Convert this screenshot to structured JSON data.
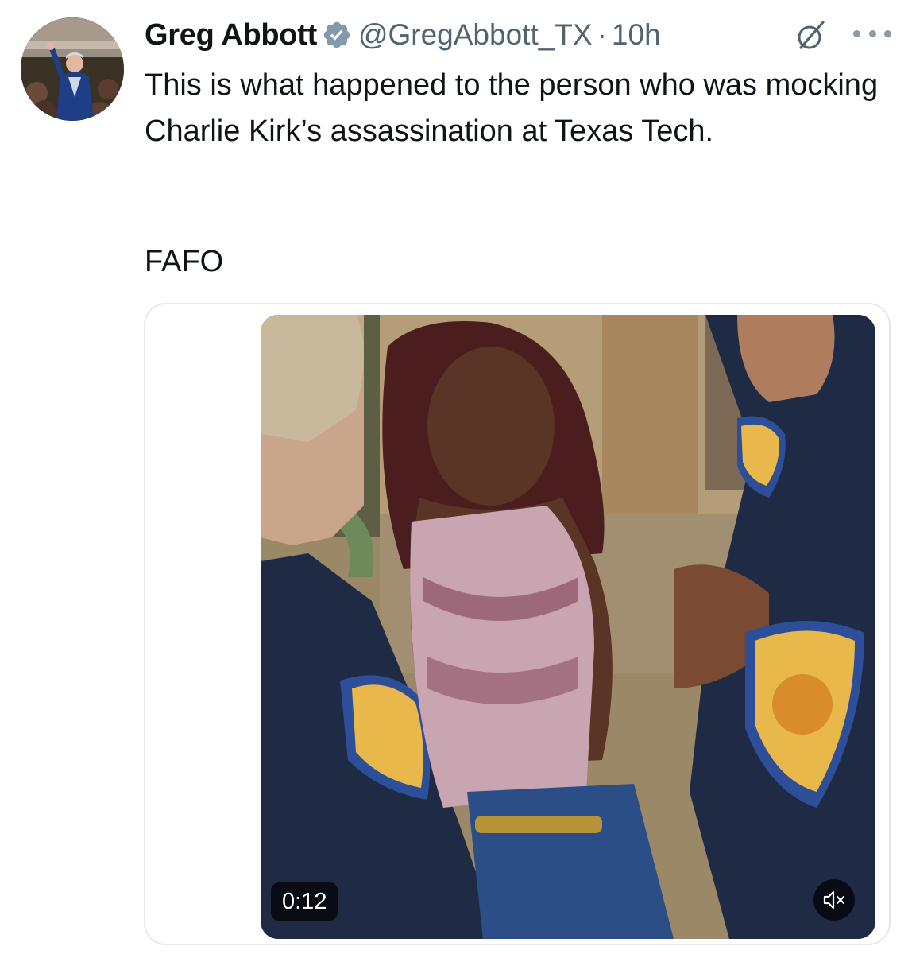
{
  "tweet": {
    "author_name": "Greg Abbott",
    "handle": "@GregAbbott_TX",
    "separator": "·",
    "time": "10h",
    "text": "This is what happened to the person who was mocking Charlie Kirk’s assassination at Texas Tech.",
    "text_2": "FAFO"
  },
  "video": {
    "duration": "0:12",
    "muted": true
  },
  "icons": {
    "verified": "verified-badge-icon",
    "grok": "grok-icon",
    "more": "more-options-icon",
    "mute": "speaker-muted-icon"
  },
  "colors": {
    "verified_badge": "#829aab",
    "secondary_text": "#536471",
    "primary_text": "#0f1419",
    "card_border": "#e6e9ec"
  }
}
